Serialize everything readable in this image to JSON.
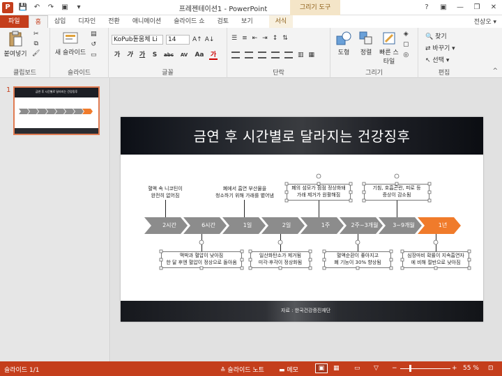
{
  "app": {
    "window_title": "프레젠테이션1 - PowerPoint",
    "context_tab_title": "그리기 도구",
    "logo_letter": "P",
    "user": "전상오",
    "window_buttons": [
      "?",
      "▣",
      "—",
      "❐",
      "✕"
    ]
  },
  "tabs": [
    "파일",
    "홈",
    "삽입",
    "디자인",
    "전환",
    "애니메이션",
    "슬라이드 쇼",
    "검토",
    "보기",
    "서식"
  ],
  "ribbon": {
    "clipboard": {
      "label": "클립보드",
      "paste": "붙여넣기"
    },
    "slides": {
      "label": "슬라이드",
      "new_slide": "새 슬라이드"
    },
    "font": {
      "label": "글꼴",
      "font_name": "KoPub돋움체 Li",
      "font_size": "14",
      "buttons": [
        "가",
        "가",
        "가",
        "S",
        "abc",
        "AV",
        "Aa",
        "가"
      ]
    },
    "paragraph": {
      "label": "단락"
    },
    "drawing": {
      "label": "그리기",
      "shapes": "도형",
      "arrange": "정렬",
      "quick_styles": "빠른 스타일"
    },
    "editing": {
      "label": "편집",
      "find": "찾기",
      "replace": "바꾸기",
      "select": "선택"
    }
  },
  "thumbnail": {
    "number": "1",
    "title": "금연 후 시간별로 달라지는 건강징후"
  },
  "slide": {
    "title": "금연 후 시간별로 달라지는 건강징후",
    "source": "자료 : 한국건강증진재단",
    "steps": [
      "2시간",
      "6시간",
      "1일",
      "2일",
      "1주",
      "2주~3개월",
      "3~9개월",
      "1년"
    ],
    "notes_top": [
      {
        "lines": [
          "혈액 속 니코틴이",
          "완전히 없어짐"
        ]
      },
      {
        "lines": [
          "폐에서 흡연 부산물을",
          "청소하기 위해 가래를 뱉어냄"
        ]
      },
      {
        "lines": [
          "폐의 섬모가 점점 정상화돼",
          "가래 제거가 원활해짐"
        ]
      },
      {
        "lines": [
          "기침, 호흡곤란, 피로 등",
          "증상이 감소됨"
        ]
      }
    ],
    "notes_bottom": [
      {
        "lines": [
          "맥박과 혈압이 낮아짐",
          "한 달 후엔 혈압이 정상으로 돌아옴"
        ]
      },
      {
        "lines": [
          "일산화탄소가 제거됨",
          "미각·후각이 정상화됨"
        ]
      },
      {
        "lines": [
          "혈액순환이 좋아지고",
          "폐 기능이 30% 향상됨"
        ]
      },
      {
        "lines": [
          "심장마비 확률이 지속흡연자",
          "에 비해 절반으로 낮아짐"
        ]
      }
    ]
  },
  "statusbar": {
    "slide_count": "슬라이드 1/1",
    "notes": "슬라이드 노트",
    "comments": "메모",
    "zoom": "55 %"
  },
  "colors": {
    "accent": "#c43e1c",
    "chevron_gray": "#8c8c8c",
    "chevron_orange": "#f07b2b"
  }
}
